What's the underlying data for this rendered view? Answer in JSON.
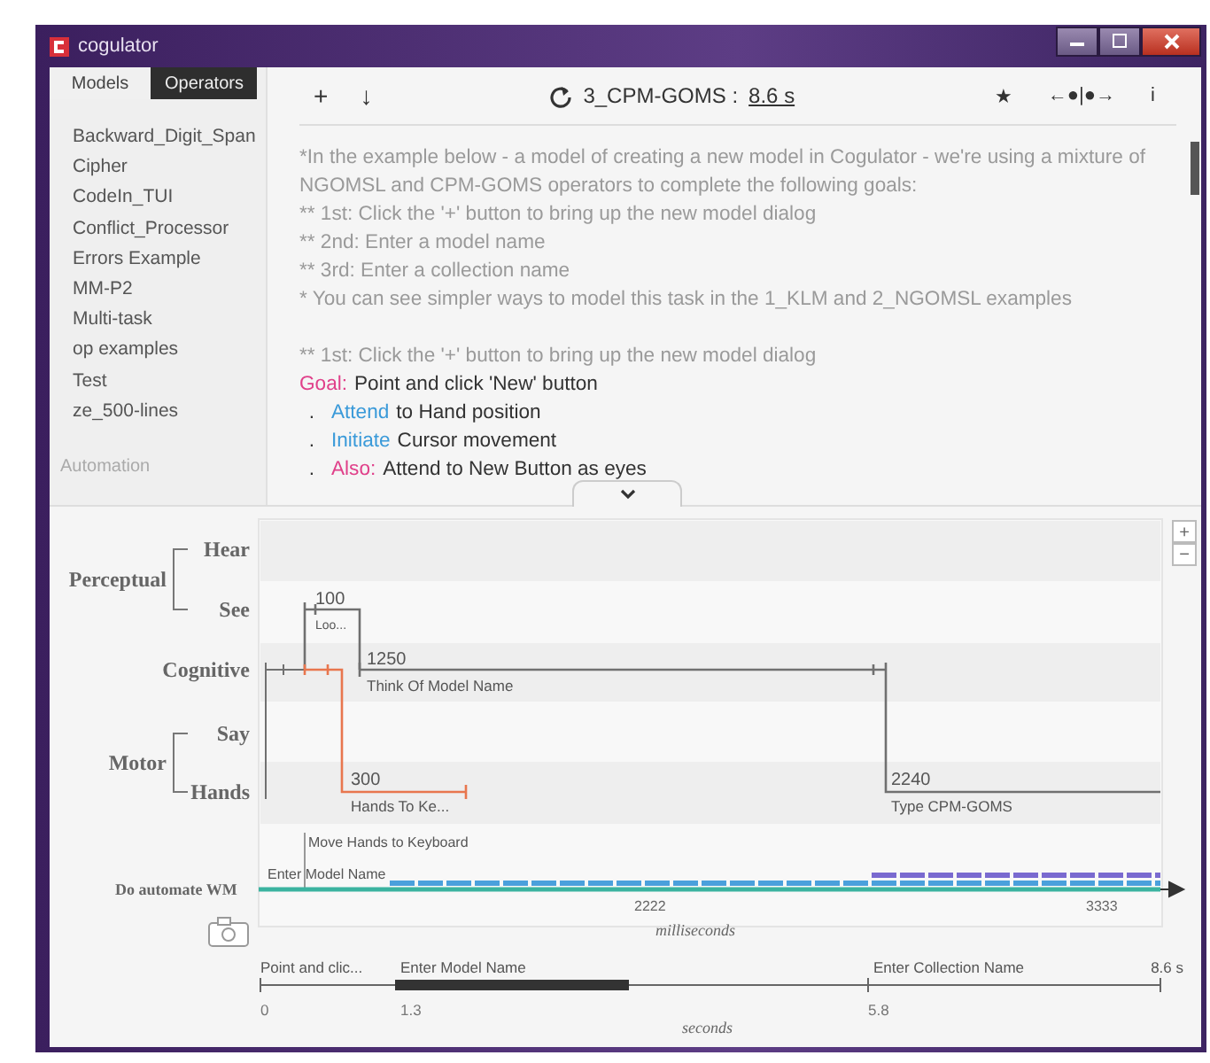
{
  "window": {
    "title": "cogulator"
  },
  "sidebar": {
    "tabs": [
      {
        "label": "Models",
        "selected": true
      },
      {
        "label": "Operators",
        "selected": false
      }
    ],
    "items": [
      "Backward_Digit_Span",
      "Cipher",
      "CodeIn_TUI",
      "Conflict_Processor",
      "Errors Example",
      "MM-P2",
      "Multi-task",
      "op examples",
      "Test",
      "ze_500-lines"
    ],
    "section": "Automation"
  },
  "toolbar": {
    "add": "+",
    "download": "↓",
    "model_title": "3_CPM-GOMS :",
    "runtime": "8.6 s",
    "star": "★",
    "nav": "←●|●→",
    "info": "i"
  },
  "editor": {
    "lines": [
      {
        "kind": "comment",
        "text": "*In the example below - a model of creating a new model in Cogulator - we're using a mixture of"
      },
      {
        "kind": "comment",
        "text": "NGOMSL and CPM-GOMS operators to complete the following goals:"
      },
      {
        "kind": "comment",
        "text": "** 1st:  Click the '+' button to bring up the new model dialog"
      },
      {
        "kind": "comment",
        "text": "** 2nd: Enter a model name"
      },
      {
        "kind": "comment",
        "text": "**  3rd: Enter a collection name"
      },
      {
        "kind": "comment",
        "text": "* You can see simpler ways to model this task in the 1_KLM and 2_NGOMSL examples"
      },
      {
        "kind": "blank"
      },
      {
        "kind": "comment",
        "text": "** 1st:  Click the '+' button to bring up the new model dialog"
      },
      {
        "kind": "goal",
        "keyword": "Goal:",
        "text": "Point and click 'New' button"
      },
      {
        "kind": "operator",
        "bullet": ".",
        "keyword": "Attend",
        "text": "to Hand position"
      },
      {
        "kind": "operator",
        "bullet": ".",
        "keyword": "Initiate",
        "text": "Cursor movement"
      },
      {
        "kind": "also",
        "bullet": ".",
        "keyword": "Also:",
        "text": "Attend to New Button as eyes"
      }
    ]
  },
  "timeline": {
    "groups": [
      {
        "label": "Perceptual",
        "rows": [
          "Hear",
          "See"
        ]
      },
      {
        "rows": [
          "Cognitive"
        ]
      },
      {
        "label": "Motor",
        "rows": [
          "Say",
          "Hands"
        ]
      }
    ],
    "operators": [
      {
        "duration": "100",
        "name": "Loo...",
        "color": "#707070"
      },
      {
        "duration": "1250",
        "name": "Think Of Model Name",
        "color": "#707070"
      },
      {
        "duration": "300",
        "name": "Hands To Ke...",
        "color": "#e8764e"
      },
      {
        "duration": "2240",
        "name": "Type CPM-GOMS",
        "color": "#707070"
      }
    ],
    "zoom": {
      "in": "+",
      "out": "−"
    },
    "wm": {
      "toggle": "Do automate WM",
      "chunks": [
        "Move Hands to Keyboard",
        "Enter Model Name"
      ],
      "ticks": [
        "2222",
        "3333"
      ],
      "axis_label": "milliseconds"
    }
  },
  "overview": {
    "goals": [
      "Point and clic...",
      "Enter Model Name",
      "Enter Collection Name"
    ],
    "end": "8.6 s",
    "ticks": [
      "0",
      "1.3",
      "5.8"
    ],
    "axis_label": "seconds"
  }
}
